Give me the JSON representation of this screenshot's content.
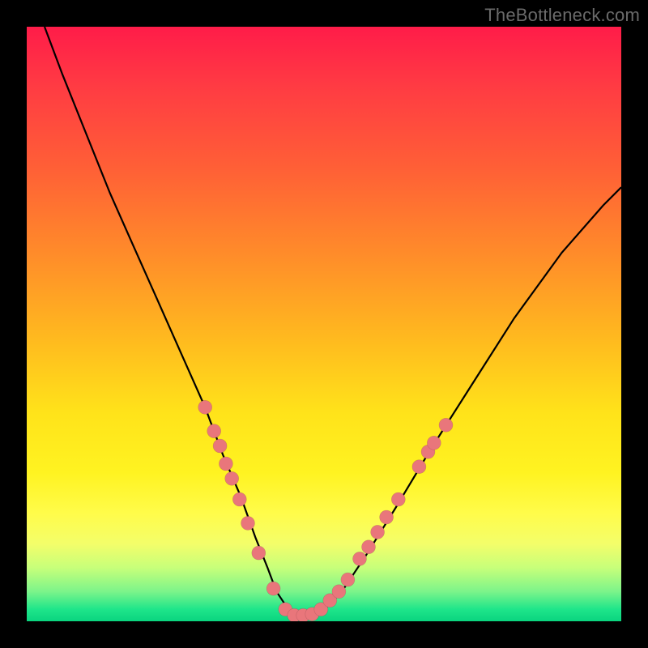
{
  "watermark": "TheBottleneck.com",
  "colors": {
    "frame": "#000000",
    "gradient_top": "#ff1c49",
    "gradient_mid": "#ffe31a",
    "gradient_bottom": "#0ad47f",
    "curve": "#000000",
    "dot": "#e9767b"
  },
  "chart_data": {
    "type": "line",
    "title": "",
    "xlabel": "",
    "ylabel": "",
    "xlim": [
      0,
      100
    ],
    "ylim": [
      0,
      100
    ],
    "series": [
      {
        "name": "curve",
        "x": [
          3,
          6,
          10,
          14,
          18,
          22,
          26,
          30,
          33,
          36,
          38.5,
          40.5,
          42,
          44,
          46,
          48,
          50,
          53,
          57,
          62,
          68,
          75,
          82,
          90,
          97,
          100
        ],
        "y": [
          100,
          92,
          82,
          72,
          63,
          54,
          45,
          36,
          28,
          21,
          14,
          9,
          5,
          2,
          1,
          1,
          2,
          5,
          11,
          19,
          29,
          40,
          51,
          62,
          70,
          73
        ]
      }
    ],
    "dots": [
      {
        "x": 30.0,
        "y": 36.0
      },
      {
        "x": 31.5,
        "y": 32.0
      },
      {
        "x": 32.5,
        "y": 29.5
      },
      {
        "x": 33.5,
        "y": 26.5
      },
      {
        "x": 34.5,
        "y": 24.0
      },
      {
        "x": 35.8,
        "y": 20.5
      },
      {
        "x": 37.2,
        "y": 16.5
      },
      {
        "x": 39.0,
        "y": 11.5
      },
      {
        "x": 41.5,
        "y": 5.5
      },
      {
        "x": 43.5,
        "y": 2.0
      },
      {
        "x": 45.0,
        "y": 1.0
      },
      {
        "x": 46.5,
        "y": 1.0
      },
      {
        "x": 48.0,
        "y": 1.2
      },
      {
        "x": 49.5,
        "y": 2.0
      },
      {
        "x": 51.0,
        "y": 3.5
      },
      {
        "x": 52.5,
        "y": 5.0
      },
      {
        "x": 54.0,
        "y": 7.0
      },
      {
        "x": 56.0,
        "y": 10.5
      },
      {
        "x": 57.5,
        "y": 12.5
      },
      {
        "x": 59.0,
        "y": 15.0
      },
      {
        "x": 60.5,
        "y": 17.5
      },
      {
        "x": 62.5,
        "y": 20.5
      },
      {
        "x": 66.0,
        "y": 26.0
      },
      {
        "x": 67.5,
        "y": 28.5
      },
      {
        "x": 68.5,
        "y": 30.0
      },
      {
        "x": 70.5,
        "y": 33.0
      }
    ]
  }
}
